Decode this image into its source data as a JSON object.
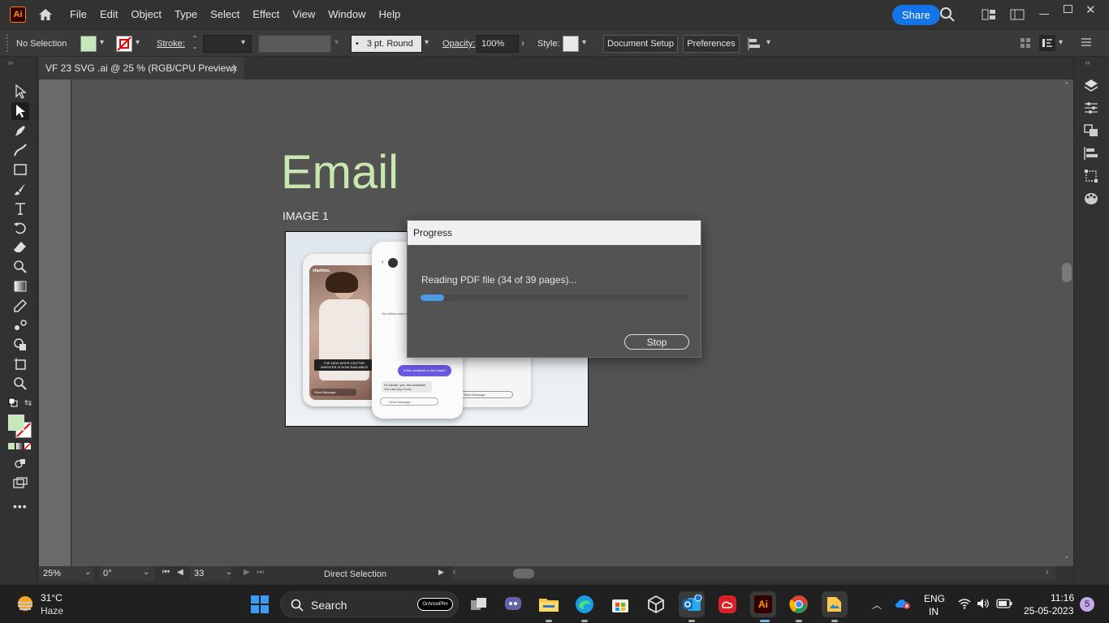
{
  "app": {
    "logo": "Ai",
    "name": "Adobe Illustrator"
  },
  "menu": [
    "File",
    "Edit",
    "Object",
    "Type",
    "Select",
    "Effect",
    "View",
    "Window",
    "Help"
  ],
  "header": {
    "share_label": "Share"
  },
  "control_bar": {
    "selection": "No Selection",
    "stroke_label": "Stroke:",
    "brush_dot": "•",
    "brush": "3 pt. Round",
    "opacity_label": "Opacity:",
    "opacity_value": "100%",
    "style_label": "Style:",
    "document_setup": "Document Setup",
    "preferences": "Preferences"
  },
  "document_tab": {
    "title": "VF 23 SVG .ai @ 25 % (RGB/CPU Preview)",
    "close": "×"
  },
  "artboard": {
    "heading": "Email",
    "sub_label": "IMAGE 1",
    "phone1_brand": "vfashion.",
    "phone1_banner": "THE NEW WHITE KNITTED SWEATER IS NOW AVAILABLE!",
    "phone1_input": "Send Message",
    "phone2_text": "You follow each other",
    "phone2_bubble": "Is this available in size small?",
    "phone2_reply": "Hi Zainab, yes, this available. You can buy it now.",
    "phone2_input": "Send Message",
    "phone3_input": "Send Message"
  },
  "dialog": {
    "title": "Progress",
    "message": "Reading PDF file (34 of 39 pages)...",
    "progress": 0.087,
    "stop_label": "Stop"
  },
  "status_bar": {
    "zoom": "25%",
    "rotation": "0°",
    "artboard_num": "33",
    "tool_name": "Direct Selection"
  },
  "colors": {
    "accent": "#1473e6",
    "fill_swatch": "#c4e8b8",
    "heading": "#c8e8b0",
    "progress": "#4a9ae8"
  },
  "taskbar": {
    "weather_temp": "31°C",
    "weather_desc": "Haze",
    "search_label": "Search",
    "search_badge": "GrAnooPhn",
    "lang_top": "ENG",
    "lang_bottom": "IN",
    "time": "11:16",
    "date": "25-05-2023",
    "notif_count": "5"
  }
}
